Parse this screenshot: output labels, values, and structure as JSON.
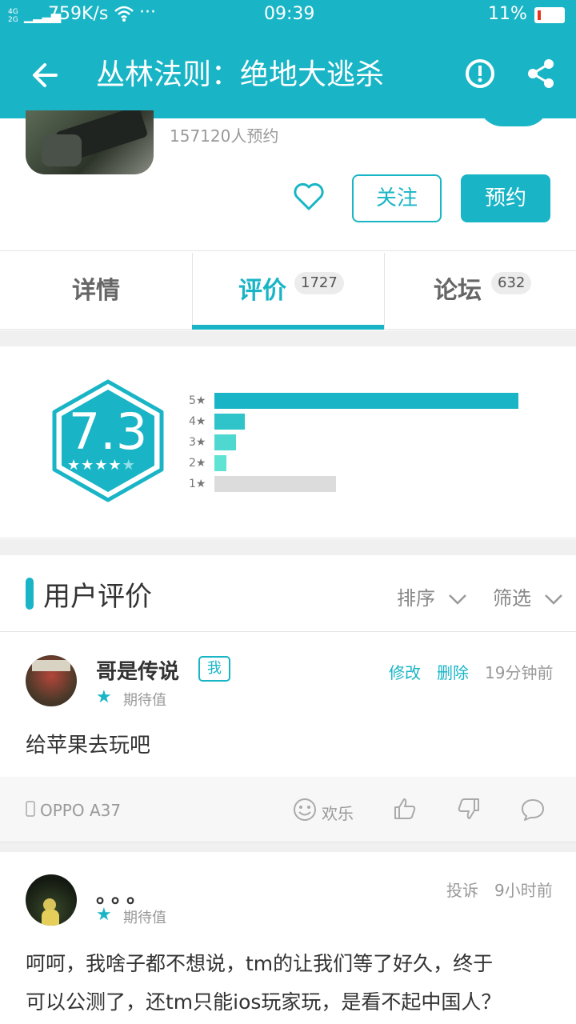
{
  "status_bar": {
    "network": "4G 2G",
    "speed": "759K/s",
    "more": "···",
    "time": "09:39",
    "battery": "11%"
  },
  "app_bar": {
    "title": "丛林法则：绝地大逃杀"
  },
  "game": {
    "reservations": "157120人预约",
    "follow_label": "关注",
    "reserve_label": "预约"
  },
  "tabs": [
    {
      "label": "详情"
    },
    {
      "label": "评价",
      "count": "1727",
      "active": true
    },
    {
      "label": "论坛",
      "count": "632"
    }
  ],
  "rating": {
    "score": "7.3",
    "stars": 3.7,
    "distribution": [
      {
        "label": "5",
        "fraction": 1.0
      },
      {
        "label": "4",
        "fraction": 0.1
      },
      {
        "label": "3",
        "fraction": 0.07
      },
      {
        "label": "2",
        "fraction": 0.04
      },
      {
        "label": "1",
        "fraction": 0.4
      }
    ]
  },
  "reviews_section": {
    "title": "用户评价",
    "sort_label": "排序",
    "filter_label": "筛选"
  },
  "reviews": [
    {
      "username": "哥是传说",
      "me_badge": "我",
      "edit": "修改",
      "delete": "删除",
      "time": "19分钟前",
      "tag": "期待值",
      "content": "给苹果去玩吧",
      "device": "OPPO A37",
      "mood": "欢乐"
    },
    {
      "username": "。。。",
      "report": "投诉",
      "time": "9小时前",
      "tag": "期待值",
      "content_line1": "呵呵，我啥子都不想说，tm的让我们等了好久，终于",
      "content_line2": "可以公测了，还tm只能ios玩家玩，是看不起中国人？"
    }
  ],
  "colors": {
    "accent": "#19b5c6",
    "bar_5": "#19b5c6",
    "bar_4": "#2fc4c9",
    "bar_3": "#4fd8cf",
    "bar_2": "#5fe3d2",
    "bar_1": "#dcdcdc"
  }
}
